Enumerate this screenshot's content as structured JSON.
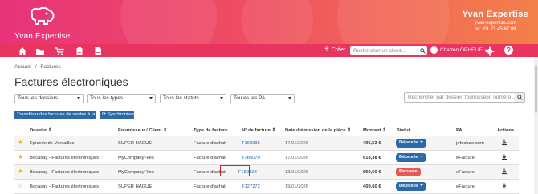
{
  "brand": {
    "logo_text": "Yvan Expertise",
    "name": "Yvan Expertise",
    "site": "yvan-expertise.com",
    "tel": "tel : 01.23.45.67.89"
  },
  "nav": {
    "create_label": "Créer",
    "search_placeholder": "Rechercher un client...",
    "user_name": "Charton OPHELIE",
    "help_label": "?"
  },
  "breadcrumb": {
    "home": "Accueil",
    "sep": "/",
    "current": "Factures"
  },
  "page_title": "Factures électroniques",
  "filters": {
    "dossiers": "Tous les dossiers",
    "types": "Tous les types",
    "statuts": "Tous les statuts",
    "pa": "Toutes les PA",
    "search_placeholder": "Rechercher par dossier, fournisseur, numéro ..."
  },
  "actions": {
    "transfer": "Transférer des factures de ventes à la PA",
    "sync": "Synchroniser"
  },
  "table": {
    "headers": [
      "Dossier",
      "Fournisseur / Client",
      "Type de facture",
      "N° de facture",
      "Date d'émission de la pièce",
      "Montant",
      "Statut",
      "PA",
      "Actions"
    ],
    "rows": [
      {
        "starred": true,
        "dossier": "Epicerie de Versailles",
        "fournisseur": "SUPER HAGUE",
        "type": "Facture d'achat",
        "numero": "F160936",
        "date": "17/01/2026",
        "montant": "495,53 €",
        "statut": "Déposée",
        "statut_kind": "ok",
        "pa": "jefacture.com"
      },
      {
        "starred": true,
        "dossier": "Bocasay - Factures électroniques",
        "fournisseur": "MyCompanyFiles",
        "type": "Facture d'achat",
        "numero": "F785070",
        "date": "17/01/2026",
        "montant": "618,38 €",
        "statut": "Déposée",
        "statut_kind": "ok",
        "pa": "eFacture"
      },
      {
        "starred": true,
        "dossier": "Bocasay - Factures électroniques",
        "fournisseur": "MyCompanyFiles",
        "type": "Facture d'achat",
        "numero": "F159828",
        "date": "13/01/2026",
        "montant": "659,60 €",
        "statut": "Refusée",
        "statut_kind": "ko",
        "pa": "eFacture"
      },
      {
        "starred": false,
        "dossier": "Bocasay - Factures électroniques",
        "fournisseur": "SUPER HAGUE",
        "type": "Facture d'achat",
        "numero": "F127272",
        "date": "19/01/2026",
        "montant": "409,60 €",
        "statut": "Déposée",
        "statut_kind": "ok",
        "pa": "eFacture"
      }
    ]
  },
  "colors": {
    "accent_blue": "#2b69a8",
    "nav_pink": "#e8345f",
    "refused_red": "#e15a58",
    "star_yellow": "#f0b400"
  }
}
